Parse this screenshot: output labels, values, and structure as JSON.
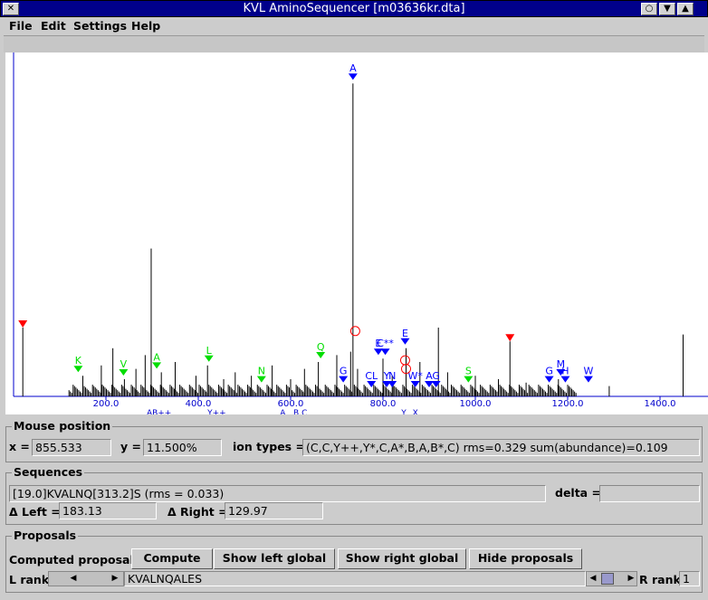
{
  "window": {
    "title": "KVL AminoSequencer [m03636kr.dta]"
  },
  "menu": [
    "File",
    "Edit",
    "Settings",
    "Help"
  ],
  "chart_data": {
    "type": "bar",
    "xlim": [
      0,
      1500
    ],
    "ylim": [
      0,
      100
    ],
    "xtick_labels": [
      "200.0",
      "400.0",
      "600.0",
      "800.0",
      "1000.0",
      "1200.0",
      "1400.0"
    ],
    "xticks": [
      200,
      400,
      600,
      800,
      1000,
      1200,
      1400
    ],
    "peaks": [
      {
        "x": 20,
        "y": 20
      },
      {
        "x": 150,
        "y": 6
      },
      {
        "x": 190,
        "y": 9
      },
      {
        "x": 215,
        "y": 14
      },
      {
        "x": 240,
        "y": 5
      },
      {
        "x": 265,
        "y": 8
      },
      {
        "x": 285,
        "y": 12
      },
      {
        "x": 298,
        "y": 43
      },
      {
        "x": 320,
        "y": 7
      },
      {
        "x": 350,
        "y": 10
      },
      {
        "x": 395,
        "y": 6
      },
      {
        "x": 420,
        "y": 9
      },
      {
        "x": 455,
        "y": 5
      },
      {
        "x": 480,
        "y": 7
      },
      {
        "x": 515,
        "y": 6
      },
      {
        "x": 560,
        "y": 9
      },
      {
        "x": 600,
        "y": 5
      },
      {
        "x": 630,
        "y": 8
      },
      {
        "x": 660,
        "y": 10
      },
      {
        "x": 700,
        "y": 12
      },
      {
        "x": 730,
        "y": 13
      },
      {
        "x": 735,
        "y": 91
      },
      {
        "x": 745,
        "y": 8
      },
      {
        "x": 800,
        "y": 11
      },
      {
        "x": 820,
        "y": 6
      },
      {
        "x": 850,
        "y": 14
      },
      {
        "x": 880,
        "y": 10
      },
      {
        "x": 920,
        "y": 20
      },
      {
        "x": 940,
        "y": 7
      },
      {
        "x": 1000,
        "y": 6
      },
      {
        "x": 1050,
        "y": 5
      },
      {
        "x": 1075,
        "y": 16
      },
      {
        "x": 1110,
        "y": 4
      },
      {
        "x": 1180,
        "y": 5
      },
      {
        "x": 1290,
        "y": 3
      },
      {
        "x": 1450,
        "y": 18
      }
    ],
    "markers": [
      {
        "label": "K",
        "x": 140,
        "color": "#00dd00"
      },
      {
        "label": "V",
        "x": 238,
        "color": "#00dd00"
      },
      {
        "label": "A",
        "x": 310,
        "color": "#00dd00"
      },
      {
        "label": "L",
        "x": 423,
        "color": "#00dd00"
      },
      {
        "label": "N",
        "x": 537,
        "color": "#00dd00"
      },
      {
        "label": "Q",
        "x": 665,
        "color": "#00dd00"
      },
      {
        "label": "S",
        "x": 985,
        "color": "#00dd00"
      },
      {
        "label": "G",
        "x": 714,
        "color": "#0000ff"
      },
      {
        "label": "A",
        "x": 735,
        "color": "#0000ff"
      },
      {
        "label": "C**",
        "x": 805,
        "color": "#0000ff"
      },
      {
        "label": "E",
        "x": 848,
        "color": "#0000ff"
      },
      {
        "label": "CL",
        "x": 775,
        "color": "#0000ff"
      },
      {
        "label": "E",
        "x": 790,
        "color": "#0000ff"
      },
      {
        "label": "Y",
        "x": 808,
        "color": "#0000ff"
      },
      {
        "label": "N",
        "x": 820,
        "color": "#0000ff"
      },
      {
        "label": "W*",
        "x": 870,
        "color": "#0000ff"
      },
      {
        "label": "A",
        "x": 900,
        "color": "#0000ff"
      },
      {
        "label": "G",
        "x": 915,
        "color": "#0000ff"
      },
      {
        "label": "G",
        "x": 1160,
        "color": "#0000ff"
      },
      {
        "label": "M",
        "x": 1185,
        "color": "#0000ff"
      },
      {
        "label": "H",
        "x": 1195,
        "color": "#0000ff"
      },
      {
        "label": "W",
        "x": 1245,
        "color": "#0000ff"
      }
    ],
    "red_markers": [
      20,
      1075
    ],
    "bottom_labels": [
      {
        "text": "AB++",
        "x": 315
      },
      {
        "text": "Y++",
        "x": 440
      },
      {
        "text": "A",
        "x": 583
      },
      {
        "text": "B",
        "x": 612
      },
      {
        "text": "C",
        "x": 630
      },
      {
        "text": "Y",
        "x": 845
      },
      {
        "text": "X",
        "x": 870
      }
    ]
  },
  "mouse": {
    "section_title": "Mouse position",
    "x_label": "x =",
    "x_value": "855.533",
    "y_label": "y =",
    "y_value": "11.500%",
    "ion_label": "ion types =",
    "ion_value": "(C,C,Y++,Y*,C,A*,B,A,B*,C) rms=0.329 sum(abundance)=0.109"
  },
  "sequences": {
    "section_title": "Sequences",
    "sequence_value": "[19.0]KVALNQ[313.2]S (rms = 0.033)",
    "delta_label": "delta =",
    "delta_value": "",
    "left_label": "Δ Left =",
    "left_value": "183.13",
    "right_label": "Δ Right =",
    "right_value": "129.97"
  },
  "proposals": {
    "section_title": "Proposals",
    "computed_label": "Computed proposals:",
    "buttons": [
      "Compute",
      "Show left global",
      "Show right global",
      "Hide proposals"
    ],
    "l_rank_label": "L rank:",
    "proposal_text": "KVALNQALES",
    "r_rank_label": "R rank:",
    "r_rank_value": "1"
  }
}
